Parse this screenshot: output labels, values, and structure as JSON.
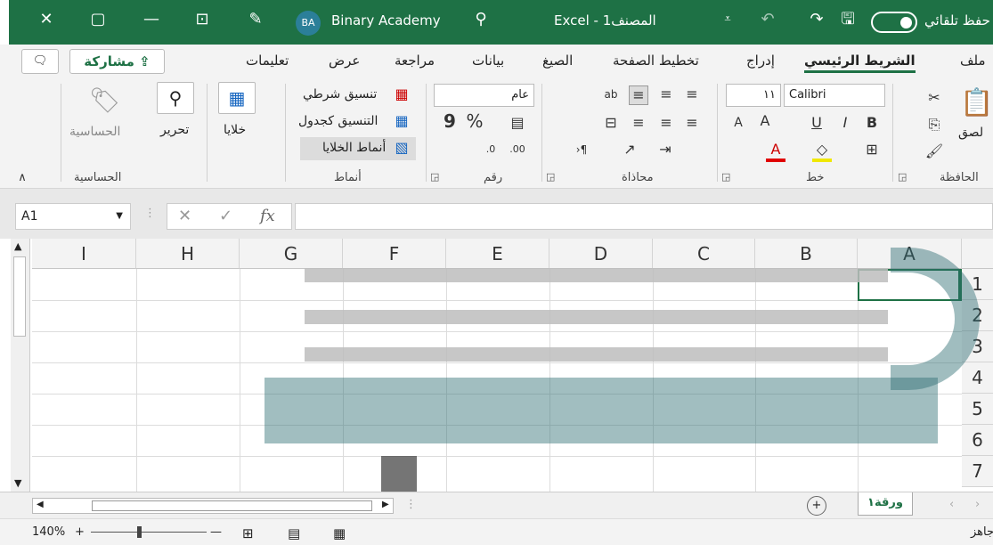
{
  "titlebar": {
    "close_glyph": "✕",
    "restore_glyph": "▢",
    "minimize_glyph": "—",
    "avatar_initials": "BA",
    "user_name": "Binary Academy",
    "search_glyph": "⚲",
    "document_title": "Excel - المصنف1",
    "autosave_label": "حفظ تلقائي"
  },
  "tabs": {
    "items": [
      "ملف",
      "الشريط الرئيسي",
      "إدراج",
      "تخطيط الصفحة",
      "الصيغ",
      "بيانات",
      "مراجعة",
      "عرض",
      "تعليمات"
    ],
    "share_label": "مشاركة"
  },
  "ribbon": {
    "clipboard": {
      "group_label": "الحافظة",
      "paste_label": "لصق"
    },
    "font": {
      "group_label": "خط",
      "font_name": "Calibri",
      "font_size": "١١",
      "bold": "B",
      "italic": "I",
      "underline": "U"
    },
    "alignment": {
      "group_label": "محاذاة"
    },
    "number": {
      "group_label": "رقم",
      "format_value": "عام",
      "percent": "%",
      "comma": "9"
    },
    "styles": {
      "group_label": "أنماط",
      "conditional": "تنسيق شرطي",
      "table": "التنسيق كجدول",
      "cell_styles": "أنماط الخلايا"
    },
    "cells": {
      "label": "خلايا"
    },
    "editing": {
      "label": "تحرير"
    },
    "sensitivity": {
      "label": "الحساسية",
      "group_label": "الحساسية"
    }
  },
  "formula_bar": {
    "name_box": "A1",
    "fx": "fx",
    "cancel": "✕",
    "enter": "✓"
  },
  "sheet": {
    "columns": [
      "A",
      "B",
      "C",
      "D",
      "E",
      "F",
      "G",
      "H",
      "I"
    ],
    "rows": [
      "1",
      "2",
      "3",
      "4",
      "5",
      "6",
      "7"
    ],
    "tab_name": "ورقة١",
    "add_sheet": "+"
  },
  "status": {
    "ready": "جاهز",
    "zoom": "140%"
  },
  "colors": {
    "accent": "#1e7145",
    "watermark": "#2f6e73"
  }
}
